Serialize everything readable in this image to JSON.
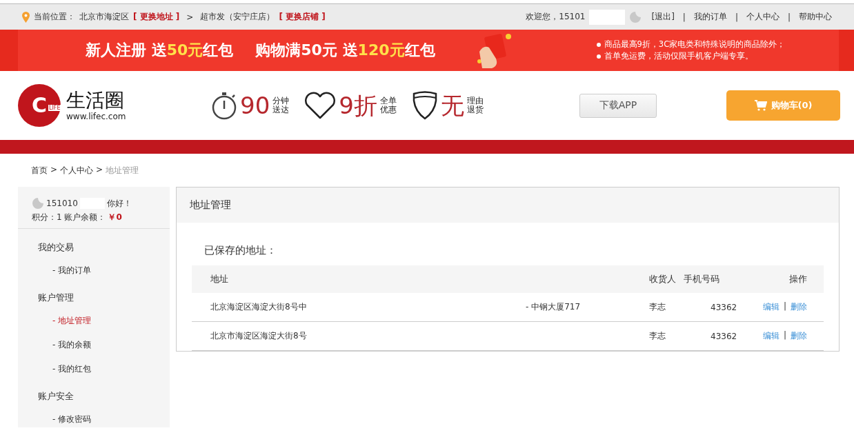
{
  "topbar": {
    "location_label": "当前位置：",
    "location": "北京市海淀区",
    "change_address": "[ 更换地址 ]",
    "separator": ">",
    "store": "超市发（安宁庄店）",
    "change_store": "[ 更换店铺 ]",
    "welcome": "欢迎您，15101",
    "links": [
      {
        "label": "[退出]"
      },
      {
        "label": "我的订单",
        "separator": "|"
      },
      {
        "label": "个人中心",
        "separator": "|"
      },
      {
        "label": "帮助中心",
        "separator": "|"
      }
    ]
  },
  "banner": {
    "offers": [
      [
        {
          "text": "新人注册 送",
          "highlight": false
        },
        {
          "text": "50元",
          "highlight": true
        },
        {
          "text": "红包",
          "highlight": false
        }
      ],
      [
        {
          "text": "购物满50元 送",
          "highlight": false
        },
        {
          "text": "120元",
          "highlight": true
        },
        {
          "text": "红包",
          "highlight": false
        }
      ]
    ],
    "notes": [
      "商品最高9折，3C家电类和特殊说明的商品除外；",
      "首单免运费，活动仅限手机客户端专享。"
    ]
  },
  "header": {
    "logo": {
      "letter": "C",
      "tag": "LIFE",
      "name": "生活圈",
      "url": "www.lifec.com"
    },
    "features": [
      {
        "kind": "stopwatch",
        "big": "90",
        "line1": "分钟",
        "line2": "送达"
      },
      {
        "kind": "heart",
        "big": "9折",
        "line1": "全单",
        "line2": "优惠"
      },
      {
        "kind": "shield",
        "big": "无",
        "line1": "理由",
        "line2": "退货"
      }
    ],
    "download": "下载APP",
    "cart": "购物车(0)"
  },
  "breadcrumb": [
    {
      "label": "首页",
      "current": false
    },
    {
      "label": "个人中心",
      "separator": ">",
      "current": false
    },
    {
      "label": "地址管理",
      "separator": ">",
      "current": true
    }
  ],
  "sidebar": {
    "user": "151010",
    "greeting": "你好！",
    "points": "积分：1 账户余额：",
    "balance": "￥0",
    "groups": [
      {
        "title": "我的交易",
        "items": [
          {
            "label": "- 我的订单",
            "selected": false
          }
        ]
      },
      {
        "title": "账户管理",
        "items": [
          {
            "label": "- 地址管理",
            "selected": true
          },
          {
            "label": "- 我的余额",
            "selected": false
          },
          {
            "label": "- 我的红包",
            "selected": false
          }
        ]
      },
      {
        "title": "账户安全",
        "items": [
          {
            "label": "- 修改密码",
            "selected": false
          }
        ]
      }
    ]
  },
  "content": {
    "title": "地址管理",
    "subtitle": "已保存的地址：",
    "columns": [
      "地址",
      "收货人",
      "手机号码",
      "操作"
    ],
    "rows": [
      {
        "address": "北京海淀区海淀大街8号中",
        "address_tail": "- 中钢大厦717",
        "name": "李志",
        "phone": "43362",
        "actions": [
          "编辑",
          "删除"
        ],
        "separator": "|"
      },
      {
        "address": "北京市海淀区海淀大街8号",
        "name": "李志",
        "phone": "43362",
        "actions": [
          "编辑",
          "删除"
        ],
        "separator": "|"
      }
    ]
  }
}
